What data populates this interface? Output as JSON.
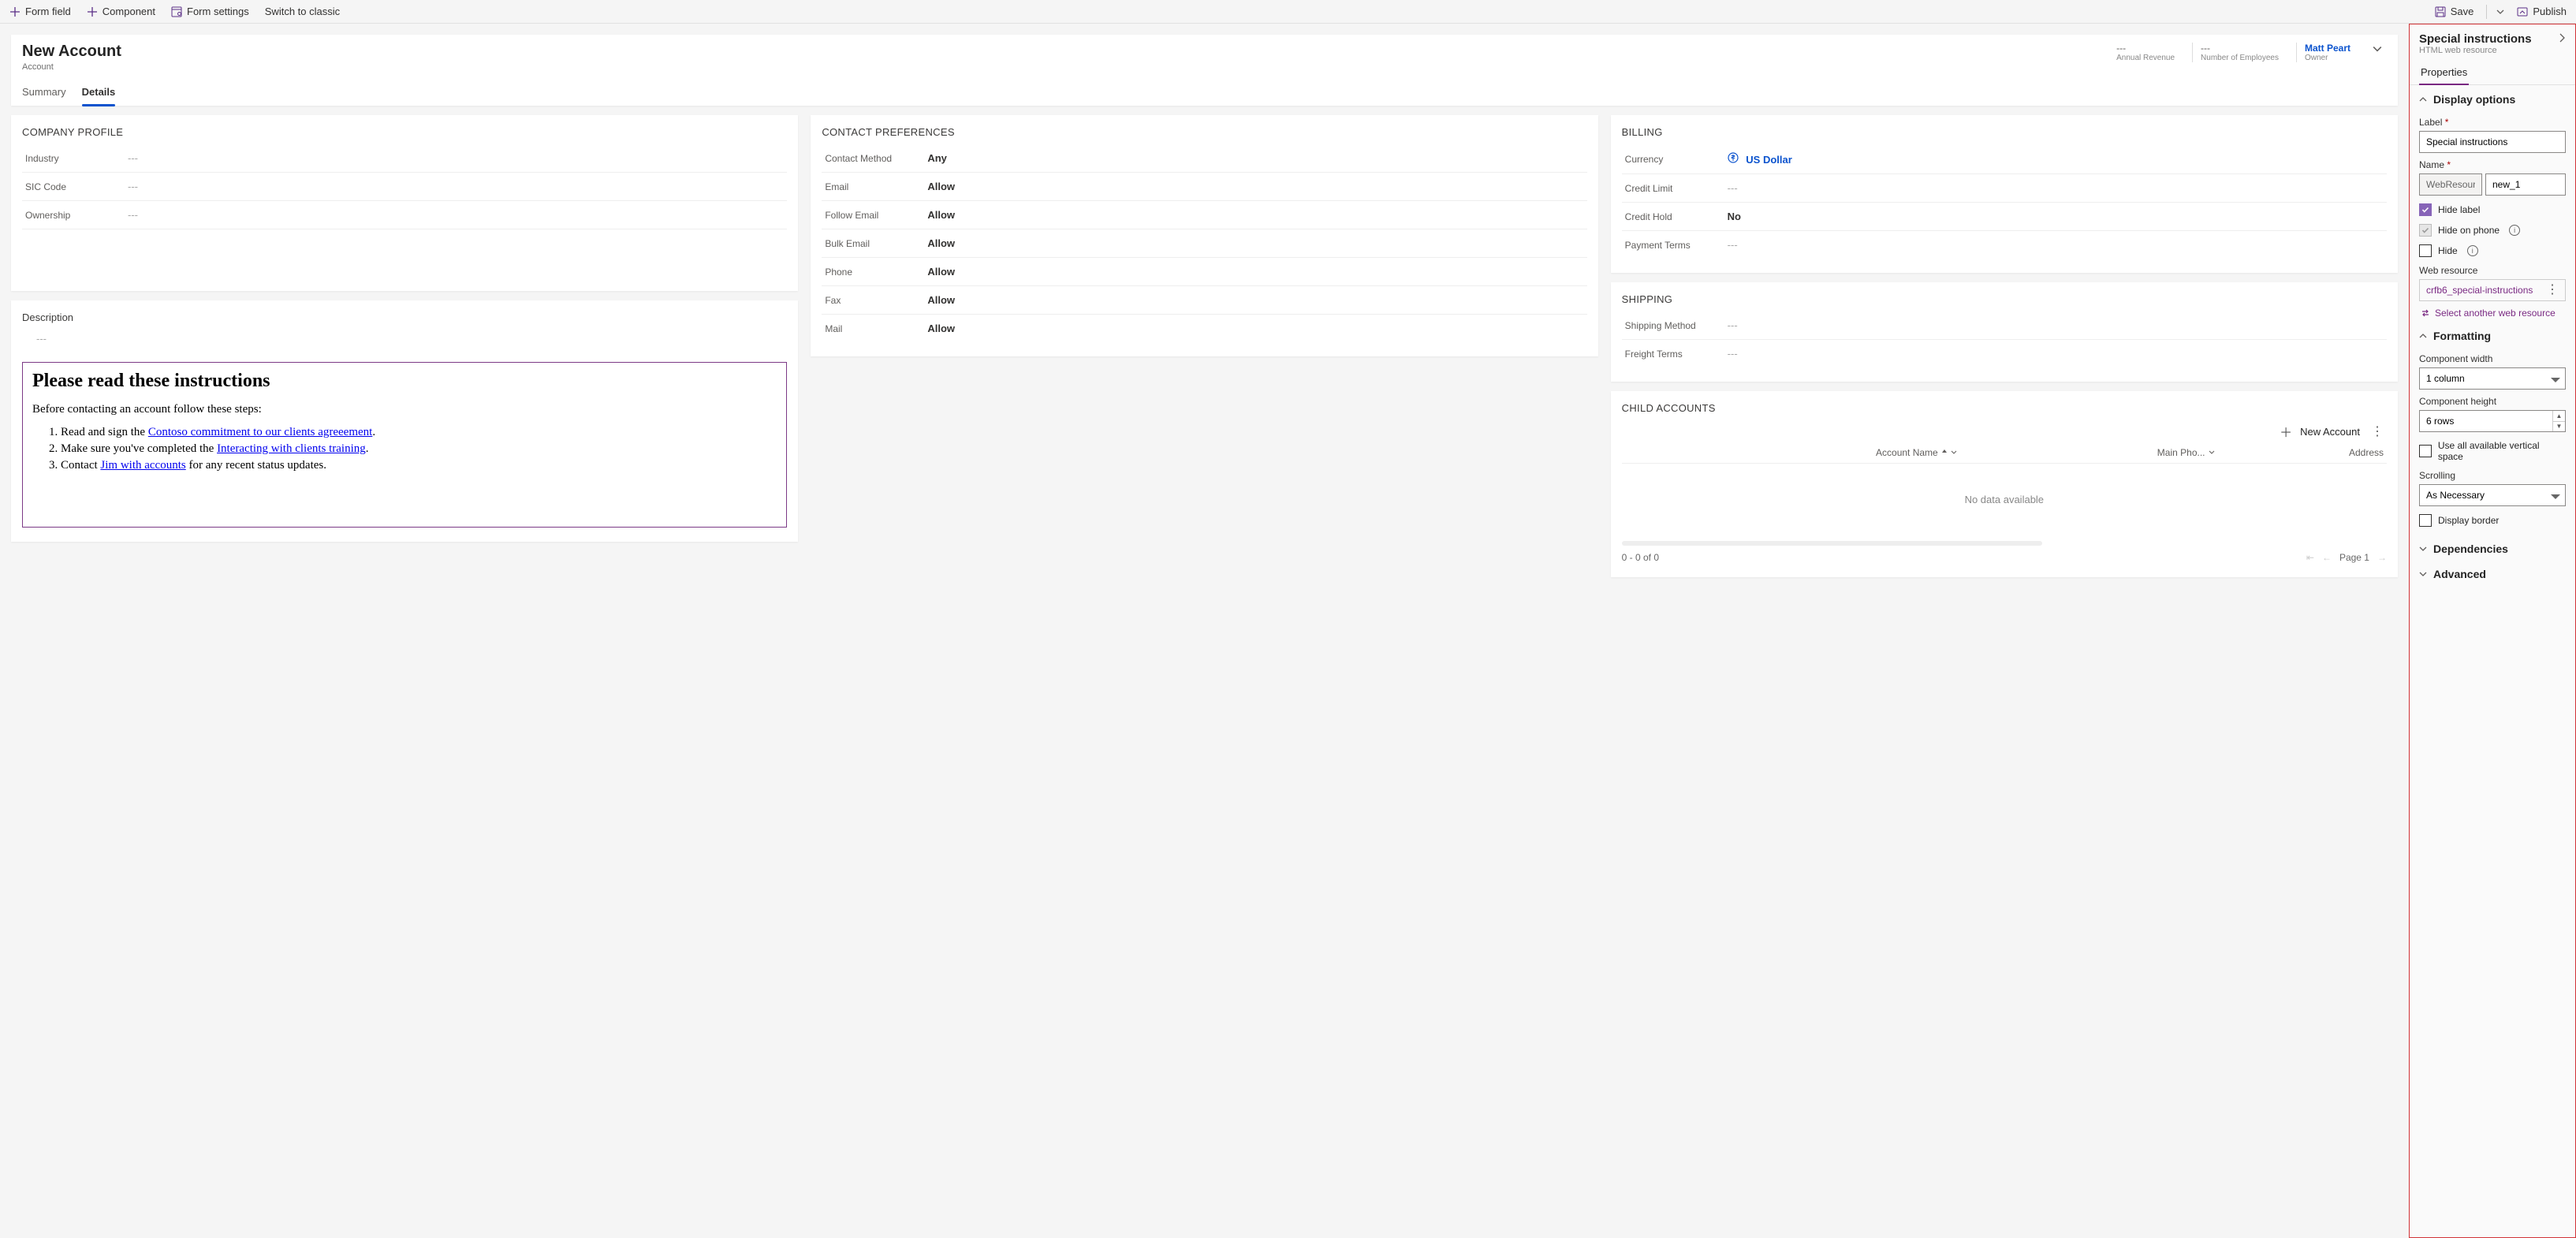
{
  "toolbar": {
    "form_field": "Form field",
    "component": "Component",
    "form_settings": "Form settings",
    "switch_classic": "Switch to classic",
    "save": "Save",
    "publish": "Publish"
  },
  "form_header": {
    "title": "New Account",
    "subtitle": "Account",
    "meta": {
      "revenue_value": "---",
      "revenue_label": "Annual Revenue",
      "employees_value": "---",
      "employees_label": "Number of Employees",
      "owner_value": "Matt Peart",
      "owner_label": "Owner"
    },
    "tabs": [
      "Summary",
      "Details"
    ],
    "active_tab": 1
  },
  "sections": {
    "company_profile": {
      "title": "COMPANY PROFILE",
      "fields": [
        {
          "label": "Industry",
          "value": "---"
        },
        {
          "label": "SIC Code",
          "value": "---"
        },
        {
          "label": "Ownership",
          "value": "---"
        }
      ]
    },
    "description": {
      "title": "Description",
      "value": "---"
    },
    "instructions": {
      "heading": "Please read these instructions",
      "intro": "Before contacting an account follow these steps:",
      "items": [
        {
          "pre": "Read and sign the ",
          "link": "Contoso commitment to our clients agreeement",
          "post": "."
        },
        {
          "pre": "Make sure you've completed the ",
          "link": "Interacting with clients training",
          "post": "."
        },
        {
          "pre": "Contact ",
          "link": "Jim with accounts",
          "post": " for any recent status updates."
        }
      ]
    },
    "contact_prefs": {
      "title": "CONTACT PREFERENCES",
      "fields": [
        {
          "label": "Contact Method",
          "value": "Any"
        },
        {
          "label": "Email",
          "value": "Allow"
        },
        {
          "label": "Follow Email",
          "value": "Allow"
        },
        {
          "label": "Bulk Email",
          "value": "Allow"
        },
        {
          "label": "Phone",
          "value": "Allow"
        },
        {
          "label": "Fax",
          "value": "Allow"
        },
        {
          "label": "Mail",
          "value": "Allow"
        }
      ]
    },
    "billing": {
      "title": "BILLING",
      "fields": [
        {
          "label": "Currency",
          "value": "US Dollar",
          "link": true
        },
        {
          "label": "Credit Limit",
          "value": "---"
        },
        {
          "label": "Credit Hold",
          "value": "No"
        },
        {
          "label": "Payment Terms",
          "value": "---"
        }
      ]
    },
    "shipping": {
      "title": "SHIPPING",
      "fields": [
        {
          "label": "Shipping Method",
          "value": "---"
        },
        {
          "label": "Freight Terms",
          "value": "---"
        }
      ]
    },
    "child_accounts": {
      "title": "CHILD ACCOUNTS",
      "new_label": "New Account",
      "columns": {
        "name": "Account Name",
        "phone": "Main Pho...",
        "address": "Address"
      },
      "empty": "No data available",
      "record_count": "0 - 0 of 0",
      "page_label": "Page 1"
    }
  },
  "prop_pane": {
    "title": "Special instructions",
    "subtitle": "HTML web resource",
    "tab": "Properties",
    "display_options": "Display options",
    "label_label": "Label",
    "label_value": "Special instructions",
    "name_label": "Name",
    "name_prefix": "WebResource_",
    "name_value": "new_1",
    "hide_label": "Hide label",
    "hide_on_phone": "Hide on phone",
    "hide": "Hide",
    "web_resource": "Web resource",
    "web_resource_value": "crfb6_special-instructions",
    "select_another": "Select another web resource",
    "formatting": "Formatting",
    "comp_width_label": "Component width",
    "comp_width_value": "1 column",
    "comp_height_label": "Component height",
    "comp_height_value": "6 rows",
    "use_all_vertical": "Use all available vertical space",
    "scrolling_label": "Scrolling",
    "scrolling_value": "As Necessary",
    "display_border": "Display border",
    "dependencies": "Dependencies",
    "advanced": "Advanced"
  }
}
